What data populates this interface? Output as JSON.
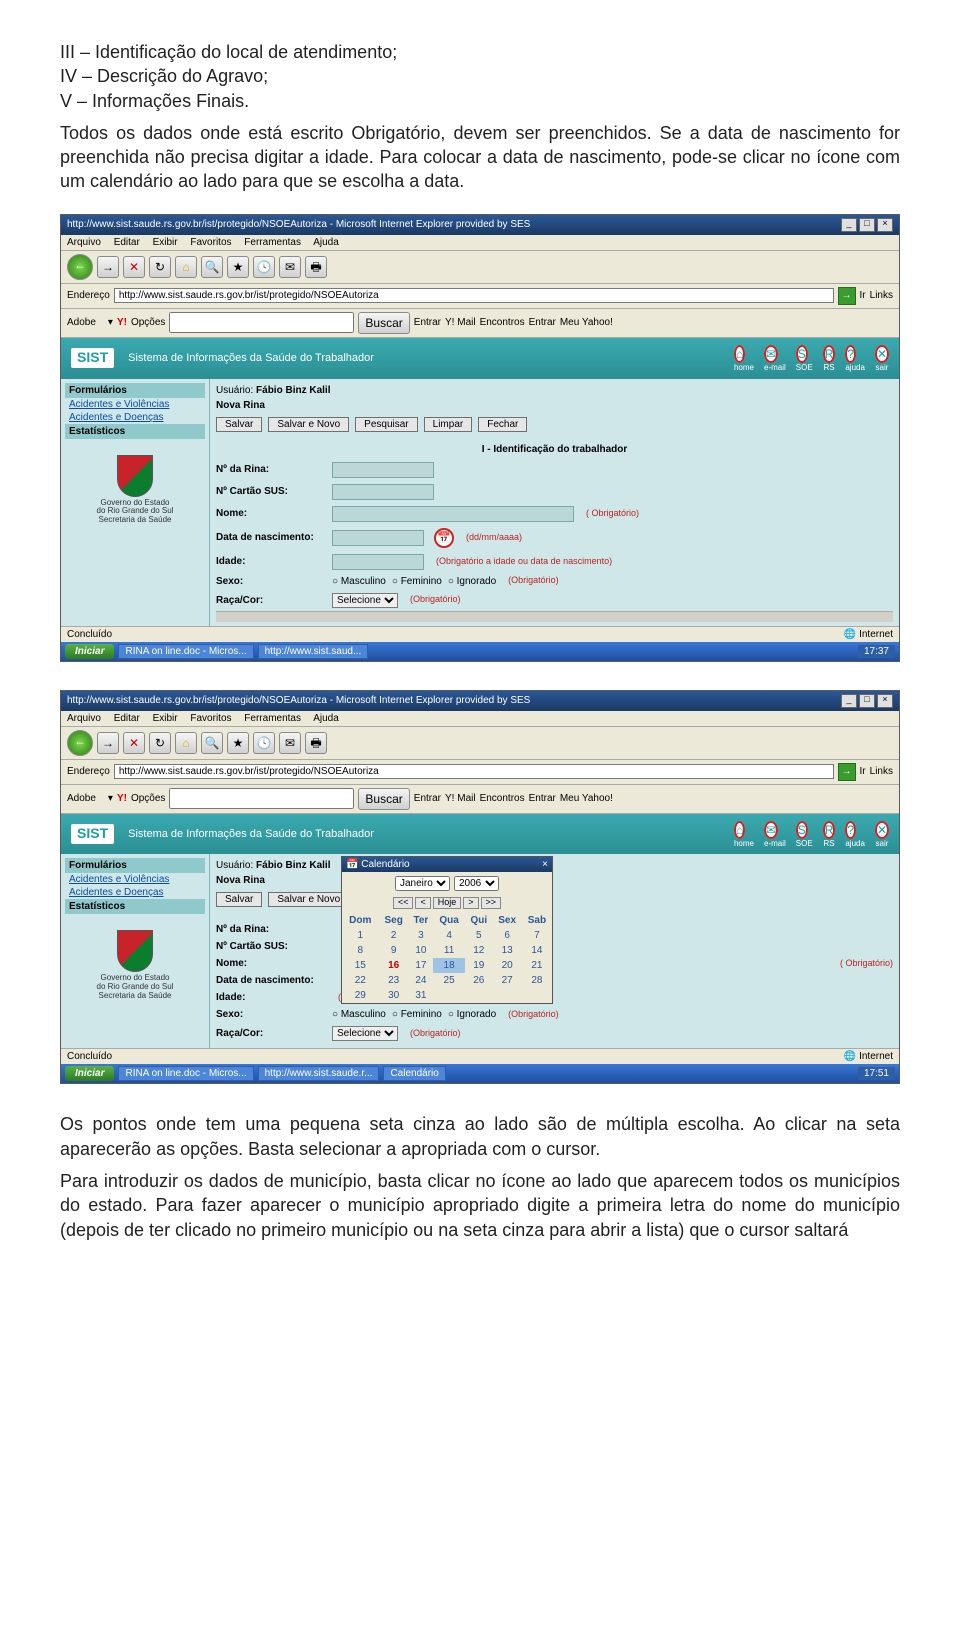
{
  "top_list": {
    "item3": "III – Identificação do local de atendimento;",
    "item4": "IV – Descrição do Agravo;",
    "item5": "V – Informações Finais."
  },
  "para1": "Todos os dados onde está escrito Obrigatório, devem ser preenchidos. Se a data de nascimento for preenchida não precisa digitar a idade. Para colocar a data de nascimento, pode-se clicar no ícone com um calendário ao lado para que se escolha a data.",
  "para2": "Os pontos onde tem uma pequena seta cinza ao lado são de múltipla escolha. Ao clicar na seta aparecerão as opções. Basta selecionar a apropriada com o cursor.",
  "para3": "Para introduzir os dados de município, basta clicar no ícone ao lado que aparecem todos os municípios do estado. Para fazer aparecer o município apropriado digite a primeira letra do nome do município (depois de ter clicado no primeiro município ou na seta cinza para abrir a lista) que o cursor saltará",
  "browser": {
    "window_title": "http://www.sist.saude.rs.gov.br/ist/protegido/NSOEAutoriza - Microsoft Internet Explorer provided by SES",
    "menus": [
      "Arquivo",
      "Editar",
      "Exibir",
      "Favoritos",
      "Ferramentas",
      "Ajuda"
    ],
    "address_label": "Endereço",
    "address_url": "http://www.sist.saude.rs.gov.br/ist/protegido/NSOEAutoriza",
    "links_label": "Links",
    "ir_label": "Ir",
    "adobe_label": "Adobe",
    "yahoo_opts": "Opções",
    "yahoo_search_label": "Buscar",
    "yahoo_items": [
      "Entrar",
      "Y! Mail",
      "Encontros",
      "Entrar",
      "Meu Yahoo!"
    ]
  },
  "sist": {
    "logo": "SIST",
    "system_title": "Sistema de Informações da Saúde do Trabalhador",
    "icons": [
      {
        "glyph": "⌂",
        "label": "home"
      },
      {
        "glyph": "✉",
        "label": "e-mail"
      },
      {
        "glyph": "S",
        "label": "SOE"
      },
      {
        "glyph": "R",
        "label": "RS"
      },
      {
        "glyph": "?",
        "label": "ajuda"
      },
      {
        "glyph": "✕",
        "label": "sair"
      }
    ],
    "user_label": "Usuário:",
    "user_name": "Fábio Binz Kalil",
    "form_name": "Nova Rina",
    "buttons1": [
      "Salvar",
      "Salvar e Novo",
      "Pesquisar",
      "Limpar",
      "Fechar"
    ],
    "buttons2": [
      "Salvar",
      "Salvar e Novo"
    ],
    "sidebar": {
      "forms_header": "Formulários",
      "link1": "Acidentes e Violências",
      "link2": "Acidentes e Doenças",
      "stats_header": "Estatísticos",
      "gov1": "Governo do Estado",
      "gov2": "do Rio Grande do Sul",
      "gov3": "Secretaria da Saúde"
    },
    "section1_title": "I - Identificação do trabalhador",
    "fields": {
      "rina": "Nº da Rina:",
      "sus": "Nº Cartão SUS:",
      "nome": "Nome:",
      "nome_hint": "( Obrigatório)",
      "dnasc": "Data de nascimento:",
      "dnasc_hint": "(dd/mm/aaaa)",
      "idade": "Idade:",
      "idade_hint": "(Obrigatório a idade ou data de nascimento)",
      "sexo": "Sexo:",
      "sexo_opts": [
        "Masculino",
        "Feminino",
        "Ignorado"
      ],
      "sexo_hint": "(Obrigatório)",
      "raca": "Raça/Cor:",
      "raca_sel": "Selecione",
      "raca_hint": "(Obrigatório)"
    }
  },
  "calendar": {
    "title": "Calendário",
    "month": "Janeiro",
    "year": "2006",
    "nav": [
      "<<",
      "<",
      "Hoje",
      ">",
      ">>"
    ],
    "dow": [
      "Dom",
      "Seg",
      "Ter",
      "Qua",
      "Qui",
      "Sex",
      "Sab"
    ],
    "weeks": [
      [
        "1",
        "2",
        "3",
        "4",
        "5",
        "6",
        "7"
      ],
      [
        "8",
        "9",
        "10",
        "11",
        "12",
        "13",
        "14"
      ],
      [
        "15",
        "16",
        "17",
        "18",
        "19",
        "20",
        "21"
      ],
      [
        "22",
        "23",
        "24",
        "25",
        "26",
        "27",
        "28"
      ],
      [
        "29",
        "30",
        "31",
        "",
        "",
        "",
        ""
      ]
    ],
    "today_cell": "16",
    "sel_cell": "18"
  },
  "statusbar": {
    "done": "Concluído",
    "zone": "Internet"
  },
  "taskbar": {
    "start": "Iniciar",
    "task1_a": "RINA on line.doc - Micros...",
    "task2_a": "http://www.sist.saud...",
    "task1_b": "RINA on line.doc - Micros...",
    "task2_b": "http://www.sist.saude.r...",
    "task3_b": "Calendário",
    "time_a": "17:37",
    "time_b": "17:51"
  }
}
